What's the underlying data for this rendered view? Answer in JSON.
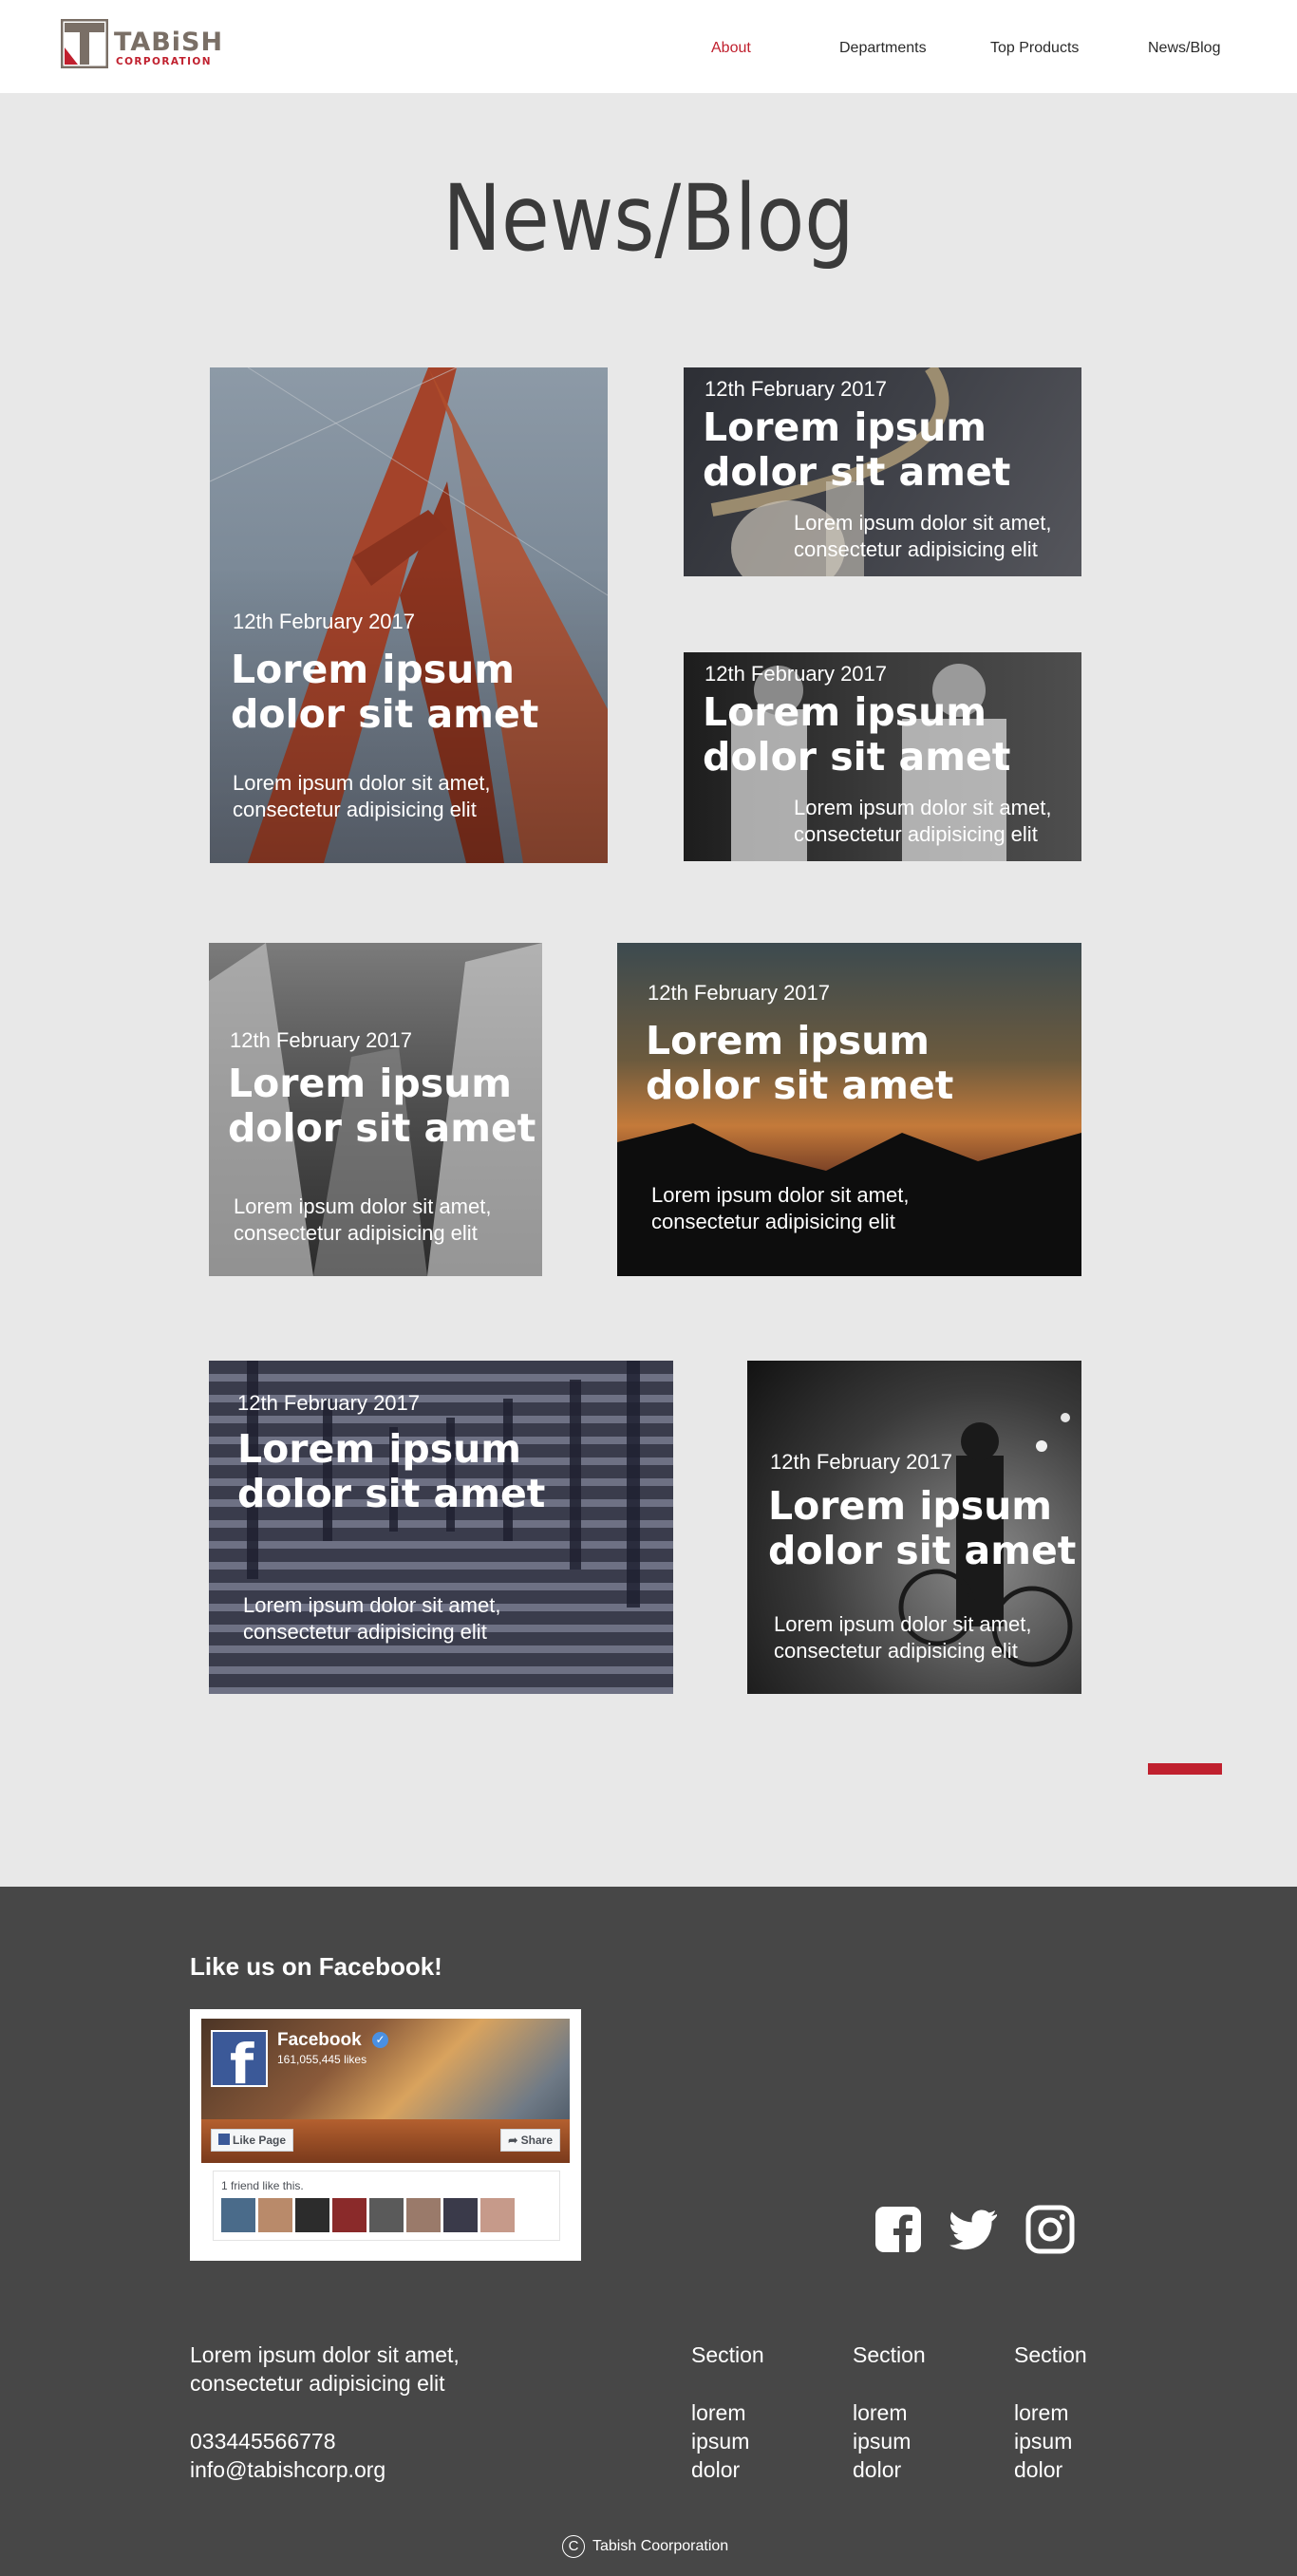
{
  "brand": {
    "name": "TABiSH",
    "sub": "CORPORATION",
    "accent": "#c0202e"
  },
  "nav": {
    "items": [
      {
        "label": "About",
        "active": true
      },
      {
        "label": "Departments",
        "active": false
      },
      {
        "label": "Top Products",
        "active": false
      },
      {
        "label": "News/Blog",
        "active": false
      }
    ]
  },
  "page_title": "News/Blog",
  "posts": [
    {
      "date": "12th February 2017",
      "title": "Lorem ipsum\ndolor sit amet",
      "excerpt": "Lorem ipsum dolor sit amet,\nconsectetur adipisicing elit"
    },
    {
      "date": "12th February 2017",
      "title": "Lorem ipsum\ndolor sit amet",
      "excerpt": "Lorem ipsum dolor sit amet,\nconsectetur adipisicing elit"
    },
    {
      "date": "12th February 2017",
      "title": "Lorem ipsum\ndolor sit amet",
      "excerpt": "Lorem ipsum dolor sit amet,\nconsectetur adipisicing elit"
    },
    {
      "date": "12th February 2017",
      "title": "Lorem ipsum\ndolor sit amet",
      "excerpt": "Lorem ipsum dolor sit amet,\nconsectetur adipisicing elit"
    },
    {
      "date": "12th February 2017",
      "title": "Lorem ipsum\ndolor sit amet",
      "excerpt": "Lorem ipsum dolor sit amet,\nconsectetur adipisicing elit"
    },
    {
      "date": "12th February 2017",
      "title": "Lorem ipsum\ndolor sit amet",
      "excerpt": "Lorem ipsum dolor sit amet,\nconsectetur adipisicing elit"
    },
    {
      "date": "12th February 2017",
      "title": "Lorem ipsum\ndolor sit amet",
      "excerpt": "Lorem ipsum dolor sit amet,\nconsectetur adipisicing elit"
    }
  ],
  "footer": {
    "facebook_heading": "Like us on Facebook!",
    "fb_widget": {
      "name": "Facebook",
      "likes": "161,055,445 likes",
      "like_button": "Like Page",
      "share_button": "Share",
      "friends_text": "1 friend like this."
    },
    "social_icons": [
      "facebook-icon",
      "twitter-icon",
      "instagram-icon"
    ],
    "about": "Lorem ipsum dolor sit amet,\nconsectetur adipisicing elit",
    "phone": "033445566778",
    "email": "info@tabishcorp.org",
    "sections": [
      {
        "heading": "Section",
        "links": [
          "lorem",
          "ipsum",
          "dolor"
        ]
      },
      {
        "heading": "Section",
        "links": [
          "lorem",
          "ipsum",
          "dolor"
        ]
      },
      {
        "heading": "Section",
        "links": [
          "lorem",
          "ipsum",
          "dolor"
        ]
      }
    ],
    "copyright": "Tabish Coorporation"
  }
}
